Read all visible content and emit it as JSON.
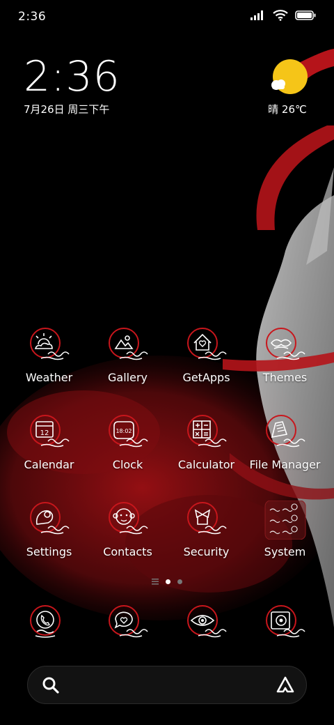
{
  "status_bar": {
    "time": "2:36",
    "icons": [
      "signal-icon",
      "wifi-icon",
      "battery-icon"
    ]
  },
  "clock_widget": {
    "time": "2:36",
    "date": "7月26日 周三下午"
  },
  "weather_widget": {
    "text": "晴 26℃",
    "icon": "sun-cloud-icon",
    "sun_color": "#f5c518"
  },
  "colors": {
    "accent_red": "#c8161c",
    "background": "#000000"
  },
  "apps": [
    {
      "label": "Weather",
      "icon": "weather-icon"
    },
    {
      "label": "Gallery",
      "icon": "gallery-icon"
    },
    {
      "label": "GetApps",
      "icon": "getapps-icon"
    },
    {
      "label": "Themes",
      "icon": "themes-icon"
    },
    {
      "label": "Calendar",
      "icon": "calendar-icon",
      "glyph": "12"
    },
    {
      "label": "Clock",
      "icon": "clock-icon",
      "glyph": "18:02"
    },
    {
      "label": "Calculator",
      "icon": "calculator-icon"
    },
    {
      "label": "File Manager",
      "icon": "file-manager-icon"
    },
    {
      "label": "Settings",
      "icon": "settings-icon"
    },
    {
      "label": "Contacts",
      "icon": "contacts-icon"
    },
    {
      "label": "Security",
      "icon": "security-icon"
    },
    {
      "label": "System",
      "icon": "system-folder-icon"
    }
  ],
  "page_indicator": {
    "pages": 2,
    "current": 1
  },
  "dock": [
    {
      "icon": "phone-icon"
    },
    {
      "icon": "messages-icon"
    },
    {
      "icon": "browser-icon"
    },
    {
      "icon": "camera-icon"
    }
  ],
  "search_bar": {
    "left_icon": "search-icon",
    "right_icon": "assistant-icon"
  }
}
